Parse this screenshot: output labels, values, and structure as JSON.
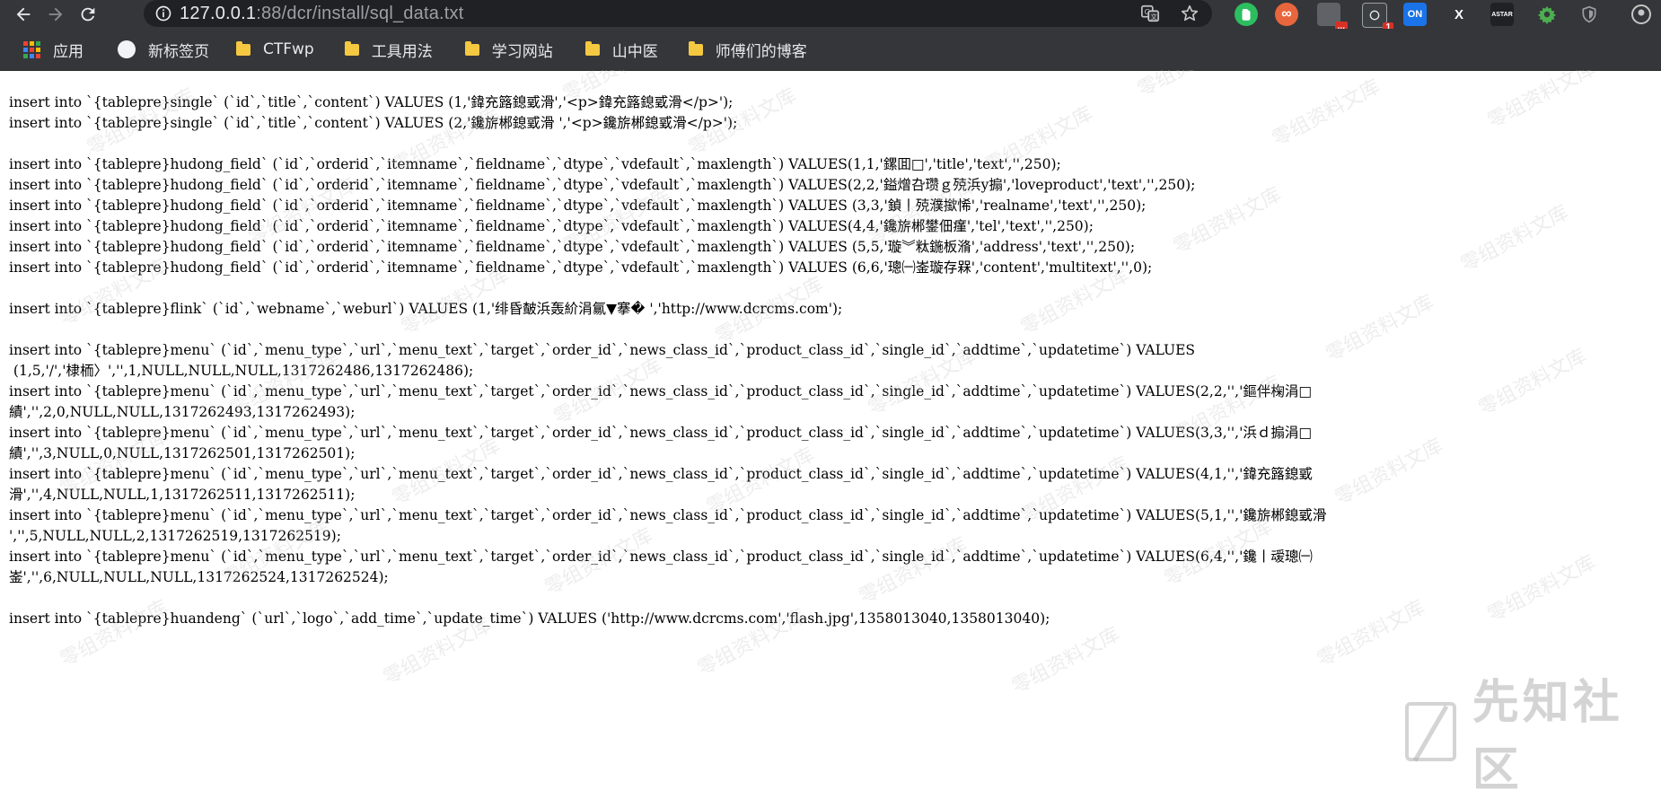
{
  "browser": {
    "url_host": "127.0.0.1",
    "url_path": ":88/dcr/install/sql_data.txt",
    "extensions": [
      {
        "name": "evernote-ext",
        "label": "",
        "color": "#2dbe60"
      },
      {
        "name": "infinity-ext",
        "label": "∞",
        "color": "#e8663d"
      },
      {
        "name": "puzzle-ext",
        "label": "",
        "color": "#8a8b8e",
        "badge": "..."
      },
      {
        "name": "recorder-ext",
        "label": "",
        "color": "#3c4043",
        "badge": "1"
      },
      {
        "name": "proxy-toggle-ext",
        "label": "ON",
        "color": "#1a73e8"
      },
      {
        "name": "x-ext",
        "label": "X",
        "color": "#35363a"
      },
      {
        "name": "astar-ext",
        "label": "ASTAR",
        "color": "#202124"
      },
      {
        "name": "gear-ext",
        "label": "",
        "color": "#4caf50"
      },
      {
        "name": "shield-ext",
        "label": "",
        "color": "#9aa0a6"
      },
      {
        "name": "profile",
        "label": "",
        "color": "#c4c7c5"
      }
    ]
  },
  "bookmarks": [
    {
      "label": "应用",
      "icon": "apps-grid-icon"
    },
    {
      "label": "新标签页",
      "icon": "globe-icon"
    },
    {
      "label": "CTFwp",
      "icon": "folder-icon"
    },
    {
      "label": "工具用法",
      "icon": "folder-icon"
    },
    {
      "label": "学习网站",
      "icon": "folder-icon"
    },
    {
      "label": "山中医",
      "icon": "folder-icon"
    },
    {
      "label": "师傅们的博客",
      "icon": "folder-icon"
    }
  ],
  "content_lines": [
    "insert into `{tablepre}single` (`id`,`title`,`content`) VALUES (1,'鍏充簬鎴戜滑','<p>鍏充簬鎴戜滑</p>');",
    "insert into `{tablepre}single` (`id`,`title`,`content`) VALUES (2,'鑱旂郴鎴戜滑 ','<p>鑱旂郴鎴戜滑</p>');",
    "",
    "insert into `{tablepre}hudong_field` (`id`,`orderid`,`itemname`,`fieldname`,`dtype`,`vdefault`,`maxlength`) VALUES(1,1,'鏍囬□','title','text','',250);",
    "insert into `{tablepre}hudong_field` (`id`,`orderid`,`itemname`,`fieldname`,`dtype`,`vdefault`,`maxlength`) VALUES(2,2,'鎰熷叴瓒ｇ殑浜у搧','loveproduct','text','',250);",
    "insert into `{tablepre}hudong_field` (`id`,`orderid`,`itemname`,`fieldname`,`dtype`,`vdefault`,`maxlength`) VALUES (3,3,'鍞丨殑濮撳悕','realname','text','',250);",
    "insert into `{tablepre}hudong_field` (`id`,`orderid`,`itemname`,`fieldname`,`dtype`,`vdefault`,`maxlength`) VALUES(4,4,'鑱旂郴鐢佃瘽','tel','text','',250);",
    "insert into `{tablepre}hudong_field` (`id`,`orderid`,`itemname`,`fieldname`,`dtype`,`vdefault`,`maxlength`) VALUES (5,5,'璇︾粏鍦板潃','address','text','',250);",
    "insert into `{tablepre}hudong_field` (`id`,`orderid`,`itemname`,`fieldname`,`dtype`,`vdefault`,`maxlength`) VALUES (6,6,'璁㈠崟璇存槑','content','multitext','',0);",
    "",
    "insert into `{tablepre}flink` (`id`,`webname`,`weburl`) VALUES (1,'绯昏皶浜轰紒涓氱▼搴� ','http://www.dcrcms.com');",
    "",
    "insert into `{tablepre}menu` (`id`,`menu_type`,`url`,`menu_text`,`target`,`order_id`,`news_class_id`,`product_class_id`,`single_id`,`addtime`,`updatetime`) VALUES",
    " (1,5,'/','棣栭〉','',1,NULL,NULL,NULL,1317262486,1317262486);",
    "insert into `{tablepre}menu` (`id`,`menu_type`,`url`,`menu_text`,`target`,`order_id`,`news_class_id`,`product_class_id`,`single_id`,`addtime`,`updatetime`) VALUES(2,2,'','鏂伴椈涓□",
    "績','',2,0,NULL,NULL,1317262493,1317262493);",
    "insert into `{tablepre}menu` (`id`,`menu_type`,`url`,`menu_text`,`target`,`order_id`,`news_class_id`,`product_class_id`,`single_id`,`addtime`,`updatetime`) VALUES(3,3,'','浜ｄ搧涓□",
    "績','',3,NULL,0,NULL,1317262501,1317262501);",
    "insert into `{tablepre}menu` (`id`,`menu_type`,`url`,`menu_text`,`target`,`order_id`,`news_class_id`,`product_class_id`,`single_id`,`addtime`,`updatetime`) VALUES(4,1,'','鍏充簬鎴戜",
    "滑','',4,NULL,NULL,1,1317262511,1317262511);",
    "insert into `{tablepre}menu` (`id`,`menu_type`,`url`,`menu_text`,`target`,`order_id`,`news_class_id`,`product_class_id`,`single_id`,`addtime`,`updatetime`) VALUES(5,1,'','鑱旂郴鎴戜滑",
    "','',5,NULL,NULL,2,1317262519,1317262519);",
    "insert into `{tablepre}menu` (`id`,`menu_type`,`url`,`menu_text`,`target`,`order_id`,`news_class_id`,`product_class_id`,`single_id`,`addtime`,`updatetime`) VALUES(6,4,'','鑱丨叆璁㈠",
    "崟','',6,NULL,NULL,NULL,1317262524,1317262524);",
    "",
    "insert into `{tablepre}huandeng` (`url`,`logo`,`add_time`,`update_time`) VALUES ('http://www.dcrcms.com','flash.jpg',1358013040,1358013040);"
  ],
  "watermark": {
    "text": "零组资料文库",
    "brand": "先知社区"
  }
}
